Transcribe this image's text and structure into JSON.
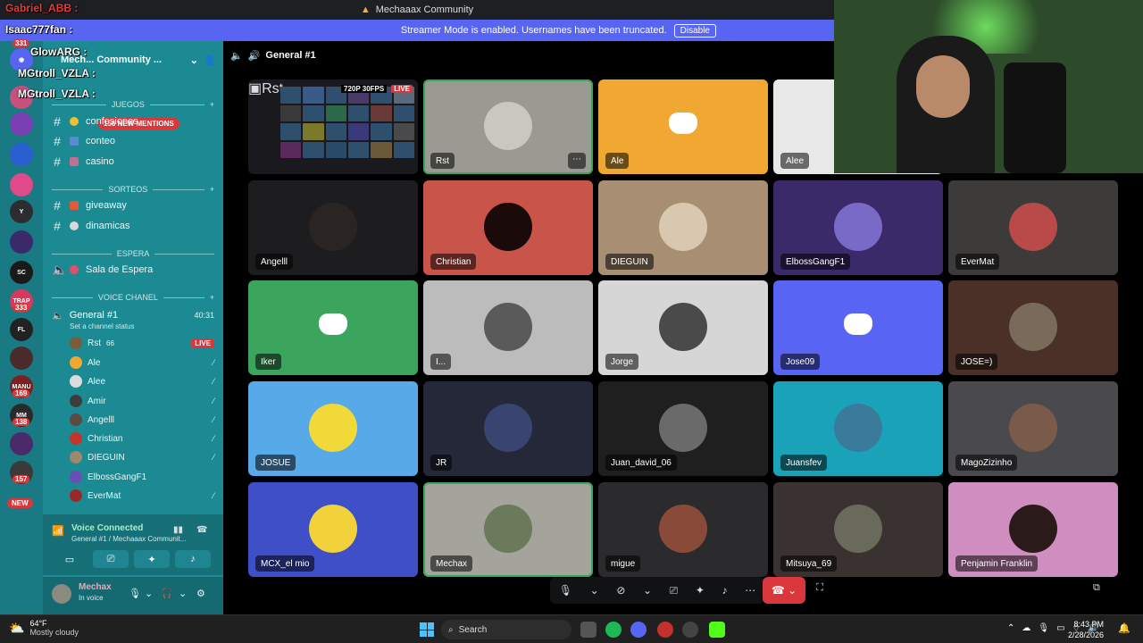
{
  "window": {
    "title": "Mechaaax Community",
    "streamer_notice": "Streamer Mode is enabled. Usernames have been truncated.",
    "disable_label": "Disable"
  },
  "overlay_chat": [
    {
      "name": "Gabriel_ABB :"
    },
    {
      "name": "Isaac777fan :"
    },
    {
      "name": "GlowARG :"
    },
    {
      "name": "MGtroll_VZLA :"
    },
    {
      "name": "MGtroll_VZLA :"
    }
  ],
  "servers": [
    {
      "badge": "331"
    },
    {
      "badge": "333"
    },
    {
      "badge": "169"
    },
    {
      "badge": "138"
    },
    {
      "badge": "157"
    },
    {
      "badge": "NEW"
    }
  ],
  "sidebar": {
    "server_name": "Mech... Community ...",
    "mentions": "156 NEW MENTIONS",
    "categories": [
      {
        "name": "JUEGOS",
        "channels": [
          "confesiones",
          "conteo",
          "casino"
        ]
      },
      {
        "name": "SORTEOS",
        "channels": [
          "giveaway",
          "dinamicas"
        ]
      },
      {
        "name": "ESPERA",
        "channels": [
          "Sala de Espera"
        ]
      },
      {
        "name": "VOICE CHANEL",
        "channels": []
      }
    ],
    "voice_channel": {
      "name": "General #1",
      "time": "40:31",
      "status": "Set a channel status",
      "members": [
        {
          "name": "Rst",
          "extra": "66",
          "live": "LIVE",
          "color": "#7a5c3a"
        },
        {
          "name": "Ale",
          "extra": "",
          "live": "",
          "color": "#f0a832"
        },
        {
          "name": "Alee",
          "extra": "",
          "live": "",
          "color": "#dcdcdc"
        },
        {
          "name": "Amir",
          "extra": "",
          "live": "",
          "color": "#3d3d3d"
        },
        {
          "name": "Angelll",
          "extra": "",
          "live": "",
          "color": "#5a4a40"
        },
        {
          "name": "Christian",
          "extra": "",
          "live": "",
          "color": "#c4352a"
        },
        {
          "name": "DIEGUIN",
          "extra": "",
          "live": "",
          "color": "#a08870"
        },
        {
          "name": "ElbossGangF1",
          "extra": "",
          "live": "",
          "color": "#6a4fb3"
        },
        {
          "name": "EverMat",
          "extra": "",
          "live": "",
          "color": "#9a2a2a"
        }
      ]
    },
    "voice_connected": {
      "title": "Voice Connected",
      "subtitle": "General #1 / Mechaaax Communit..."
    },
    "user": {
      "name": "Mechax",
      "status": "In voice"
    }
  },
  "stage": {
    "channel": "General #1",
    "stream": {
      "resolution": "720P 30FPS",
      "live": "LIVE",
      "name": "Rst"
    },
    "tiles": [
      {
        "name": "Rst",
        "bg": "#9a9a92",
        "av": "#c8c8c0",
        "type": "avatar",
        "speaking": true,
        "dots": true
      },
      {
        "name": "Ale",
        "bg": "#f0a832",
        "av": "",
        "type": "discord"
      },
      {
        "name": "Alee",
        "bg": "#e8e8e8",
        "av": "",
        "type": "partial"
      },
      {
        "name": "Angelll",
        "bg": "#1d1d1f",
        "av": "#2a2422",
        "type": "avatar"
      },
      {
        "name": "Christian",
        "bg": "#c9544a",
        "av": "#1a0a0a",
        "type": "avatar"
      },
      {
        "name": "DIEGUIN",
        "bg": "#a88f74",
        "av": "#d8c8b0",
        "type": "avatar"
      },
      {
        "name": "ElbossGangF1",
        "bg": "#3b2a6a",
        "av": "#7a6ac8",
        "type": "avatar"
      },
      {
        "name": "EverMat",
        "bg": "#3d3a3a",
        "av": "#b84a4a",
        "type": "avatar"
      },
      {
        "name": "Iker",
        "bg": "#3ba55d",
        "av": "",
        "type": "discord"
      },
      {
        "name": "I...",
        "bg": "#bcbcbc",
        "av": "#5a5a5a",
        "type": "avatar"
      },
      {
        "name": "Jorge",
        "bg": "#d6d6d6",
        "av": "#4a4a4a",
        "type": "avatar"
      },
      {
        "name": "Jose09",
        "bg": "#5865f2",
        "av": "",
        "type": "discord"
      },
      {
        "name": "JOSE=)",
        "bg": "#4a3026",
        "av": "#7a6a5a",
        "type": "avatar"
      },
      {
        "name": "JOSUE",
        "bg": "#58a9e8",
        "av": "#f2d93a",
        "type": "avatar"
      },
      {
        "name": "JR",
        "bg": "#252838",
        "av": "#3a4470",
        "type": "avatar"
      },
      {
        "name": "Juan_david_06",
        "bg": "#1f1f1f",
        "av": "#6a6a6a",
        "type": "avatar"
      },
      {
        "name": "Juansfev",
        "bg": "#1aa3b8",
        "av": "#3a7a9a",
        "type": "avatar"
      },
      {
        "name": "MagoZizinho",
        "bg": "#4a4a4e",
        "av": "#7a5a4a",
        "type": "avatar"
      },
      {
        "name": "MCX_el mio",
        "bg": "#3f4fc8",
        "av": "#f2d23a",
        "type": "avatar"
      },
      {
        "name": "Mechax",
        "bg": "#a4a49c",
        "av": "#6a7a5a",
        "type": "avatar",
        "speaking": true
      },
      {
        "name": "migue",
        "bg": "#2b2b2d",
        "av": "#8a4a3a",
        "type": "avatar"
      },
      {
        "name": "Mitsuya_69",
        "bg": "#3a3230",
        "av": "#6a6a5a",
        "type": "avatar"
      },
      {
        "name": "Penjamin Franklin",
        "bg": "#d08ec0",
        "av": "#2a1a1a",
        "type": "avatar"
      }
    ]
  },
  "taskbar": {
    "temp": "64°F",
    "condition": "Mostly cloudy",
    "search": "Search",
    "time": "8:43 PM",
    "date": "2/28/2026"
  },
  "colors": {
    "sidebar": "#1b8a93",
    "accent": "#5865f2",
    "danger": "#da373c",
    "speaking": "#3ba55d"
  }
}
